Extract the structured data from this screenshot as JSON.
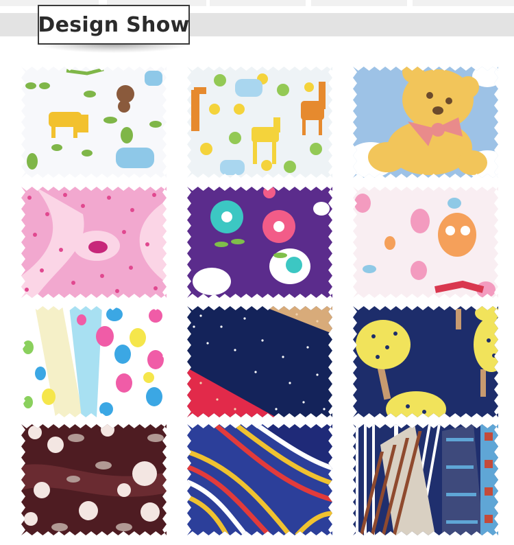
{
  "header": {
    "title": "Design Show"
  },
  "swatches": [
    {
      "pattern": "animals-on-white",
      "colors": [
        "#f7f8fb",
        "#f2c12e",
        "#7fb648",
        "#8ec8e8",
        "#8a5a3c"
      ]
    },
    {
      "pattern": "giraffes-and-frogs",
      "colors": [
        "#eef3f6",
        "#e68a2e",
        "#f4d33b",
        "#93c955",
        "#a9d6ef"
      ]
    },
    {
      "pattern": "teddy-bear",
      "colors": [
        "#9dc2e6",
        "#f2c55a",
        "#e98b8b",
        "#ffffff",
        "#6b4a2c"
      ]
    },
    {
      "pattern": "pink-florals",
      "colors": [
        "#f2a8cf",
        "#e0488f",
        "#fbd5e6",
        "#c7267a",
        "#ffffff"
      ]
    },
    {
      "pattern": "flowers-on-purple",
      "colors": [
        "#5b2c8c",
        "#ffffff",
        "#3cc7c3",
        "#f25c88",
        "#7fbf4a"
      ]
    },
    {
      "pattern": "owls-on-white",
      "colors": [
        "#f9eef2",
        "#f39bbf",
        "#f5a05a",
        "#8fc9e6",
        "#d9374f"
      ]
    },
    {
      "pattern": "polka-dots",
      "colors": [
        "#ffffff",
        "#f05ca7",
        "#3ba7e4",
        "#f5e64b",
        "#8ad05d"
      ]
    },
    {
      "pattern": "stars-on-navy",
      "colors": [
        "#14235a",
        "#e22a4a",
        "#d8ab7a",
        "#ffffff",
        "#f2d3b0"
      ]
    },
    {
      "pattern": "trees-on-navy",
      "colors": [
        "#1d2d6b",
        "#f1e35b",
        "#c79a70",
        "#2c3b7c",
        "#e7d24a"
      ]
    },
    {
      "pattern": "florals-on-maroon",
      "colors": [
        "#4e1c22",
        "#f3e6e2",
        "#b19994",
        "#6a2b31",
        "#d8c6c0"
      ]
    },
    {
      "pattern": "wavy-stripes",
      "colors": [
        "#2c3f9a",
        "#f0c230",
        "#e23b3b",
        "#ffffff",
        "#1a1f4f"
      ]
    },
    {
      "pattern": "plaid-stripes",
      "colors": [
        "#1f2f6e",
        "#ffffff",
        "#8f4a2e",
        "#5fa6d6",
        "#c44b3a"
      ]
    }
  ]
}
